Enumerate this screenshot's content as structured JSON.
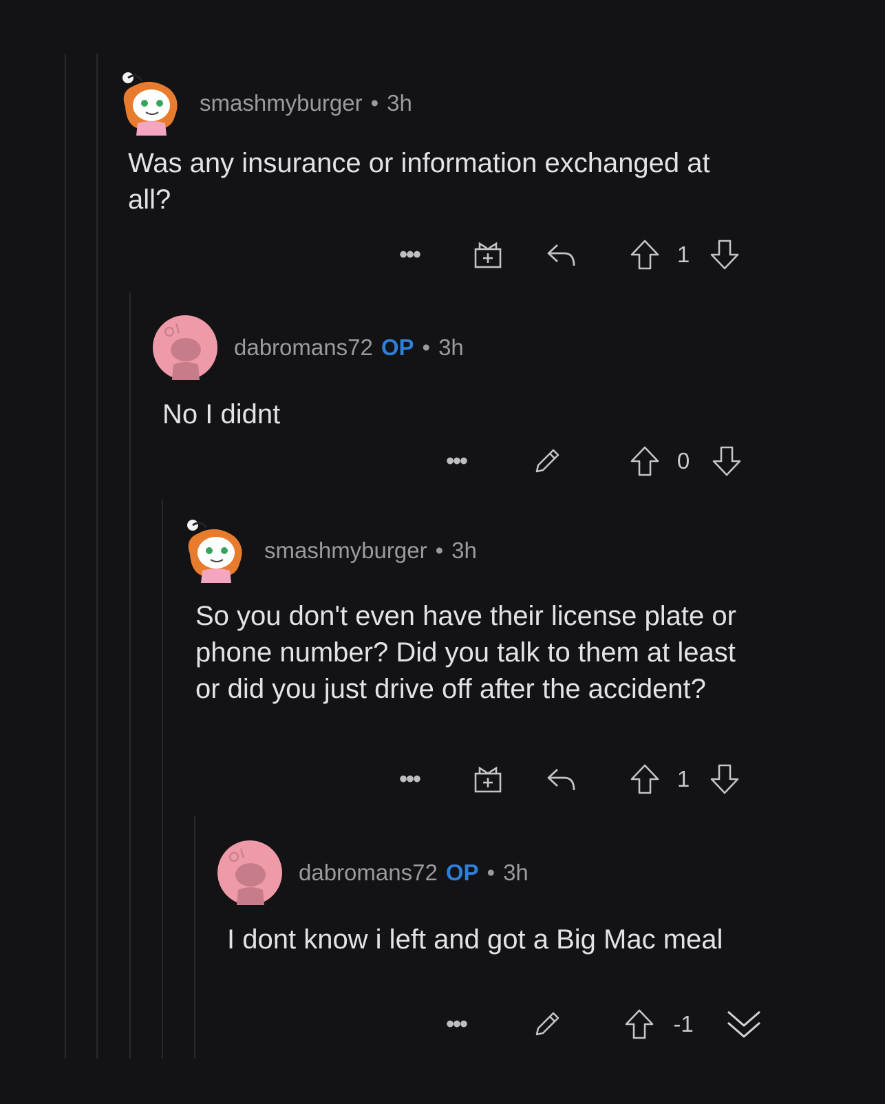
{
  "comments": [
    {
      "username": "smashmyburger",
      "op": "",
      "time": "3h",
      "text": "Was any insurance or information exchanged at all?",
      "score": "1",
      "avatar": "snoo-redhead-avatar"
    },
    {
      "username": "dabromans72",
      "op": "OP",
      "time": "3h",
      "text": "No I didnt",
      "score": "0",
      "avatar": "default-snoo-avatar"
    },
    {
      "username": "smashmyburger",
      "op": "",
      "time": "3h",
      "text": "So you don't even have their license plate or phone number? Did you talk to them at least or did you just drive off after the accident?",
      "score": "1",
      "avatar": "snoo-redhead-avatar"
    },
    {
      "username": "dabromans72",
      "op": "OP",
      "time": "3h",
      "text": "I dont know i left and got a Big Mac meal",
      "score": "-1",
      "avatar": "default-snoo-avatar"
    }
  ],
  "separator": "•",
  "more_label": "•••",
  "colors": {
    "background": "#131214",
    "op": "#2f7fd6",
    "meta": "#9a9aa0",
    "text": "#e3e3e6"
  }
}
